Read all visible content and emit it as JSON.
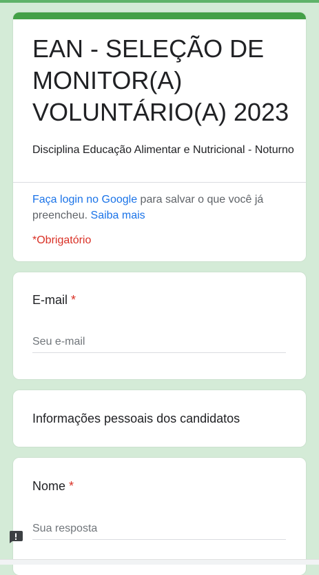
{
  "form": {
    "title": "EAN - SELEÇÃO DE MONITOR(A) VOLUNTÁRIO(A) 2023",
    "description": "Disciplina Educação Alimentar e Nutricional - Noturno",
    "login_link": "Faça login no Google",
    "login_text": " para salvar o que você já preencheu. ",
    "learn_more_link": "Saiba mais",
    "required_note": "*Obrigatório"
  },
  "questions": {
    "email": {
      "label": "E-mail",
      "required_mark": "*",
      "placeholder": "Seu e-mail"
    },
    "section_title": "Informações pessoais dos candidatos",
    "nome": {
      "label": "Nome",
      "required_mark": "*",
      "placeholder": "Sua resposta"
    }
  },
  "theme": {
    "background": "#d4ebd7",
    "accent": "#43a047",
    "link": "#1a73e8",
    "required": "#d93025"
  },
  "icons": {
    "report": "report-problem-icon"
  }
}
